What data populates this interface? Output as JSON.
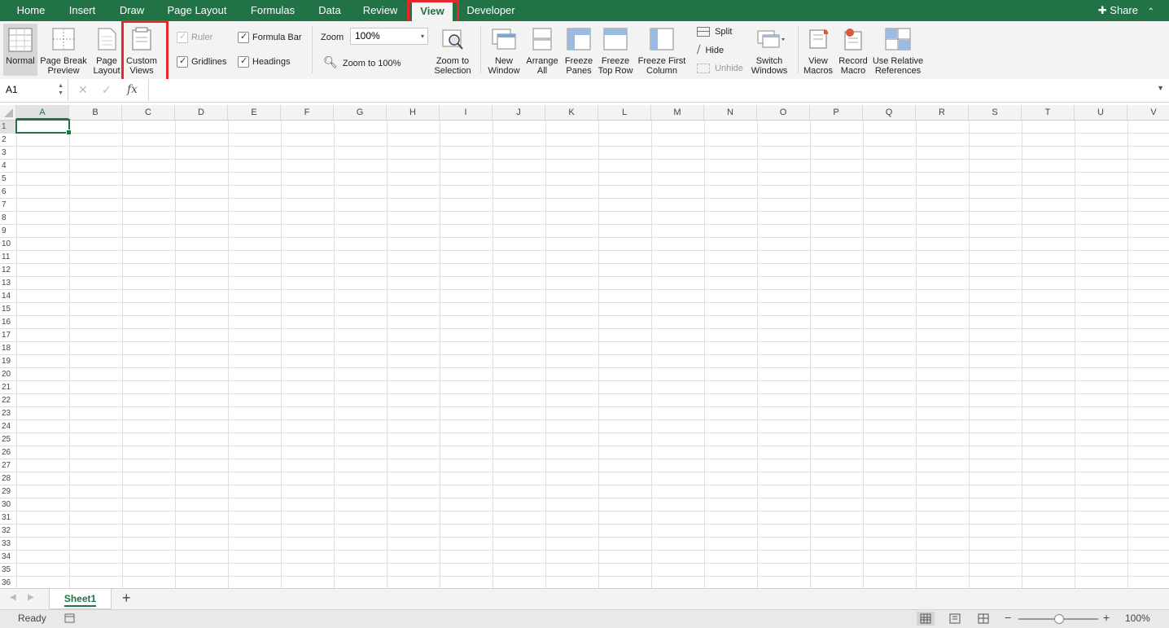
{
  "tabs": [
    "Home",
    "Insert",
    "Draw",
    "Page Layout",
    "Formulas",
    "Data",
    "Review",
    "View",
    "Developer"
  ],
  "active_tab": "View",
  "share_label": "Share",
  "ribbon": {
    "normal": "Normal",
    "page_break_1": "Page Break",
    "page_break_2": "Preview",
    "page_layout_1": "Page",
    "page_layout_2": "Layout",
    "custom_views_1": "Custom",
    "custom_views_2": "Views",
    "ruler": "Ruler",
    "formula_bar": "Formula Bar",
    "gridlines": "Gridlines",
    "headings": "Headings",
    "zoom_label": "Zoom",
    "zoom_value": "100%",
    "zoom_100": "Zoom to 100%",
    "zoom_sel_1": "Zoom to",
    "zoom_sel_2": "Selection",
    "new_window_1": "New",
    "new_window_2": "Window",
    "arrange_1": "Arrange",
    "arrange_2": "All",
    "freeze_panes_1": "Freeze",
    "freeze_panes_2": "Panes",
    "freeze_top_1": "Freeze",
    "freeze_top_2": "Top Row",
    "freeze_first_1": "Freeze First",
    "freeze_first_2": "Column",
    "split": "Split",
    "hide": "Hide",
    "unhide": "Unhide",
    "switch_1": "Switch",
    "switch_2": "Windows",
    "view_macros_1": "View",
    "view_macros_2": "Macros",
    "record_1": "Record",
    "record_2": "Macro",
    "relative_1": "Use Relative",
    "relative_2": "References"
  },
  "formula_bar": {
    "name_box": "A1",
    "fx": "fx",
    "content": ""
  },
  "columns": [
    "A",
    "B",
    "C",
    "D",
    "E",
    "F",
    "G",
    "H",
    "I",
    "J",
    "K",
    "L",
    "M",
    "N",
    "O",
    "P",
    "Q",
    "R",
    "S",
    "T",
    "U",
    "V"
  ],
  "rows": [
    "1",
    "2",
    "3",
    "4",
    "5",
    "6",
    "7",
    "8",
    "9",
    "10",
    "11",
    "12",
    "13",
    "14",
    "15",
    "16",
    "17",
    "18",
    "19",
    "20",
    "21",
    "22",
    "23",
    "24",
    "25",
    "26",
    "27",
    "28",
    "29",
    "30",
    "31",
    "32",
    "33",
    "34",
    "35",
    "36"
  ],
  "sheet_tab": "Sheet1",
  "add_sheet": "+",
  "status": {
    "ready": "Ready",
    "zoom": "100%",
    "minus": "−",
    "plus": "+"
  },
  "colors": {
    "excel_green": "#217346",
    "highlight_red": "#e8262b"
  }
}
